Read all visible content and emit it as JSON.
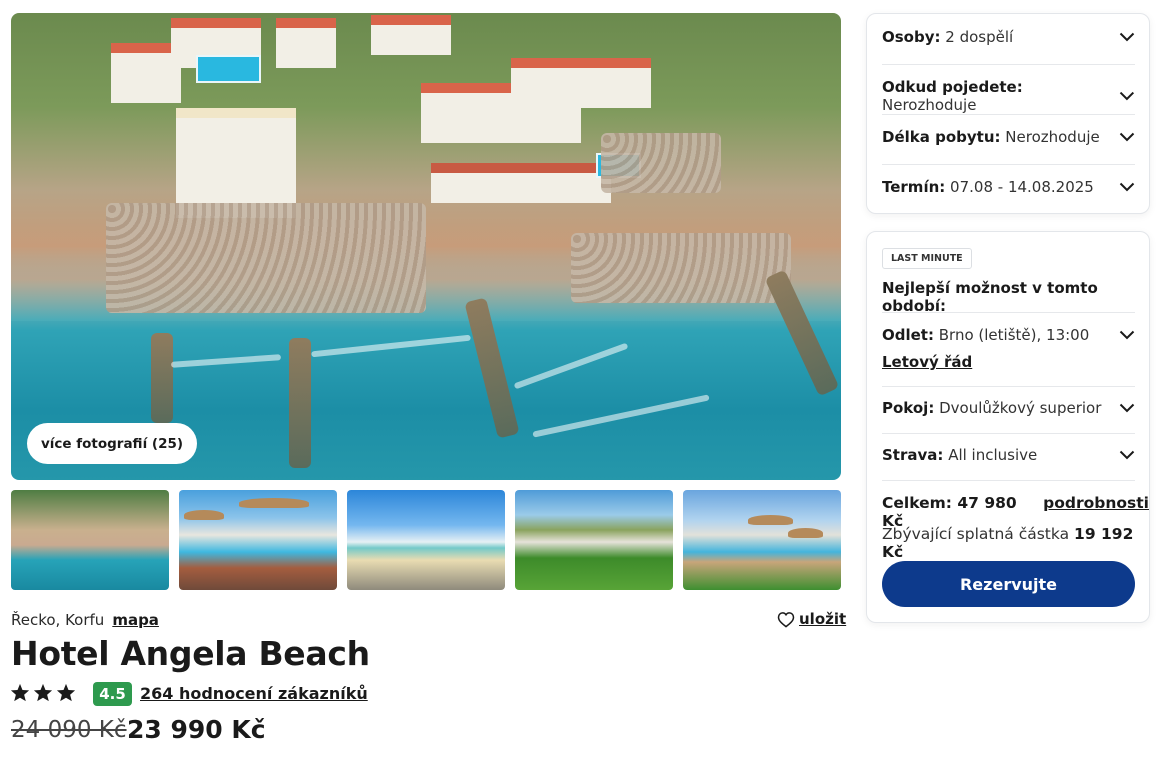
{
  "gallery": {
    "more_photos_label": "více fotografií (25)"
  },
  "hotel": {
    "location": "Řecko, Korfu",
    "map_link": "mapa",
    "save_label": "uložit",
    "name": "Hotel Angela Beach",
    "stars": 3,
    "rating": "4.5",
    "reviews_link": "264 hodnocení zákazníků",
    "old_price": "24 090 Kč",
    "price": "23 990 Kč"
  },
  "filters": {
    "persons": {
      "label": "Osoby:",
      "value": "2 dospělí"
    },
    "departure_from": {
      "label": "Odkud pojedete:",
      "value": "Nerozhoduje"
    },
    "stay_length": {
      "label": "Délka pobytu:",
      "value": "Nerozhoduje"
    },
    "term": {
      "label": "Termín:",
      "value": "07.08 - 14.08.2025"
    }
  },
  "offer": {
    "badge": "LAST MINUTE",
    "heading": "Nejlepší možnost v tomto období:",
    "flight": {
      "label": "Odlet:",
      "value": "Brno (letiště), 13:00"
    },
    "schedule_link": "Letový řád",
    "room": {
      "label": "Pokoj:",
      "value": "Dvoulůžkový superior"
    },
    "board": {
      "label": "Strava:",
      "value": "All inclusive"
    },
    "total_label": "Celkem: 47 980 Kč",
    "details_link": "podrobnosti",
    "remaining_label": "Zbývající splatná částka",
    "remaining_value": "19 192 Kč",
    "reserve_label": "Rezervujte"
  },
  "colors": {
    "accent": "#0d3a8c",
    "rating_green": "#2e9a4e"
  }
}
